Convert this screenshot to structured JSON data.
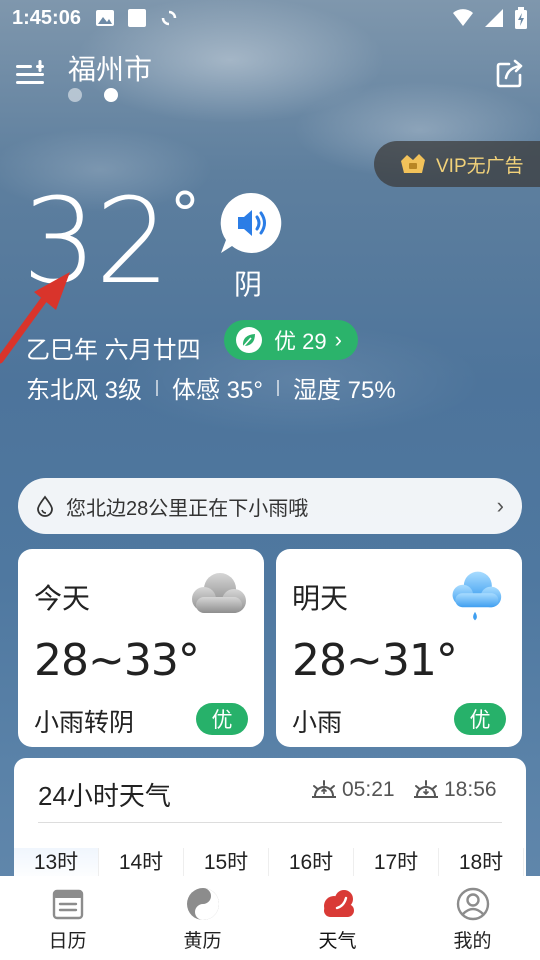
{
  "status_bar": {
    "time": "1:45:06"
  },
  "header": {
    "city": "福州市"
  },
  "vip": {
    "label": "VIP无广告"
  },
  "current": {
    "temperature": "32",
    "degree": "°",
    "condition": "阴",
    "lunar_date": "乙巳年 六月廿四",
    "aqi_label": "优 29",
    "aqi_chevron": "›",
    "wind": "东北风 3级",
    "feels_like": "体感 35°",
    "humidity": "湿度 75%"
  },
  "notice": {
    "text": "您北边28公里正在下小雨哦",
    "chevron": "›"
  },
  "forecast": {
    "today": {
      "day": "今天",
      "range": "28~33°",
      "desc": "小雨转阴",
      "aqi": "优",
      "icon": "cloudy-icon"
    },
    "tomorrow": {
      "day": "明天",
      "range": "28~31°",
      "desc": "小雨",
      "aqi": "优",
      "icon": "light-rain-icon"
    }
  },
  "hourly": {
    "title": "24小时天气",
    "sunrise": "05:21",
    "sunset": "18:56",
    "hours": [
      "13时",
      "14时",
      "15时",
      "16时",
      "17时",
      "18时"
    ]
  },
  "nav": {
    "items": [
      {
        "label": "日历",
        "icon": "calendar-icon"
      },
      {
        "label": "黄历",
        "icon": "yin-yang-icon"
      },
      {
        "label": "天气",
        "icon": "weather-icon"
      },
      {
        "label": "我的",
        "icon": "profile-icon"
      }
    ],
    "active": "天气"
  },
  "colors": {
    "aqi_green": "#2bb36b",
    "vip_gold": "#f2d27a",
    "active_red": "#d93a36",
    "annotation_red": "#d9342b"
  }
}
